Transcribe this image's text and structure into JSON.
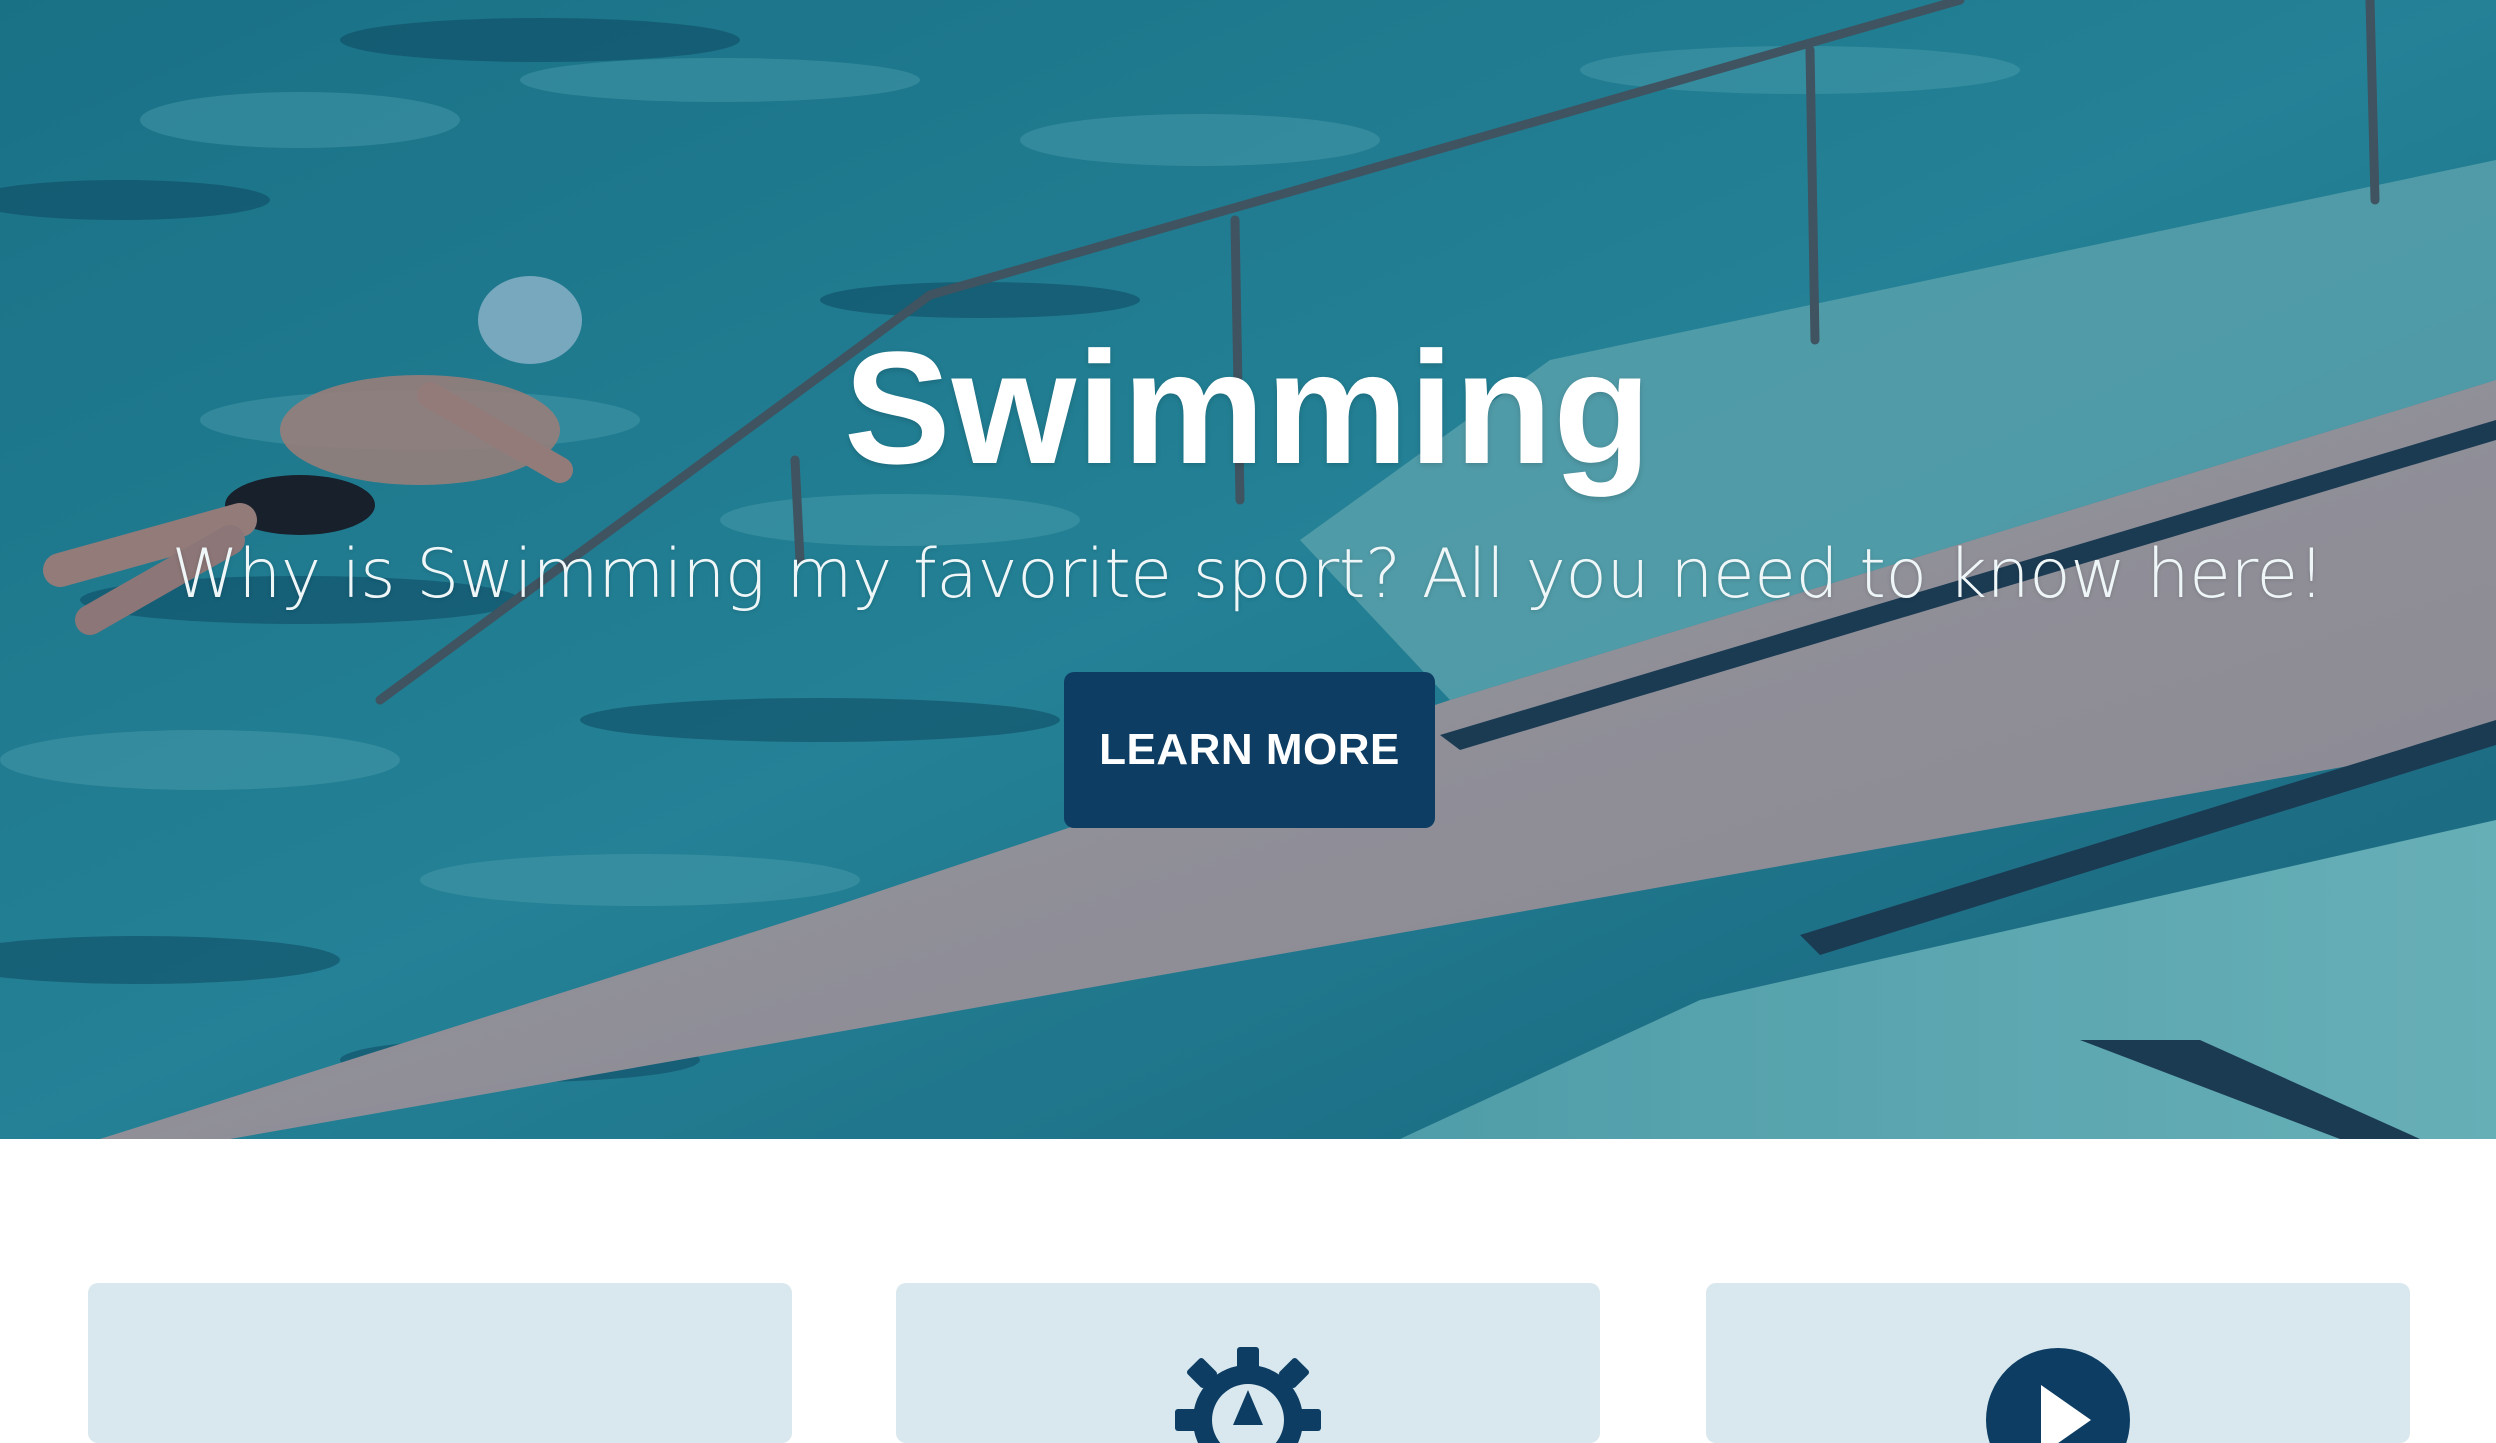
{
  "hero": {
    "title": "Swimming",
    "subtitle": "Why is Swimming my favorite sport? All you need to know here!",
    "button_label": "LEARN MORE",
    "background_image": "swimming-pool-photo"
  },
  "features": {
    "cards": [
      {
        "icon": "none"
      },
      {
        "icon": "gear-icon"
      },
      {
        "icon": "play-circle-icon"
      }
    ]
  },
  "colors": {
    "accent": "#0d3d63",
    "card_background": "#d9e8ee",
    "text_light": "#ffffff"
  }
}
